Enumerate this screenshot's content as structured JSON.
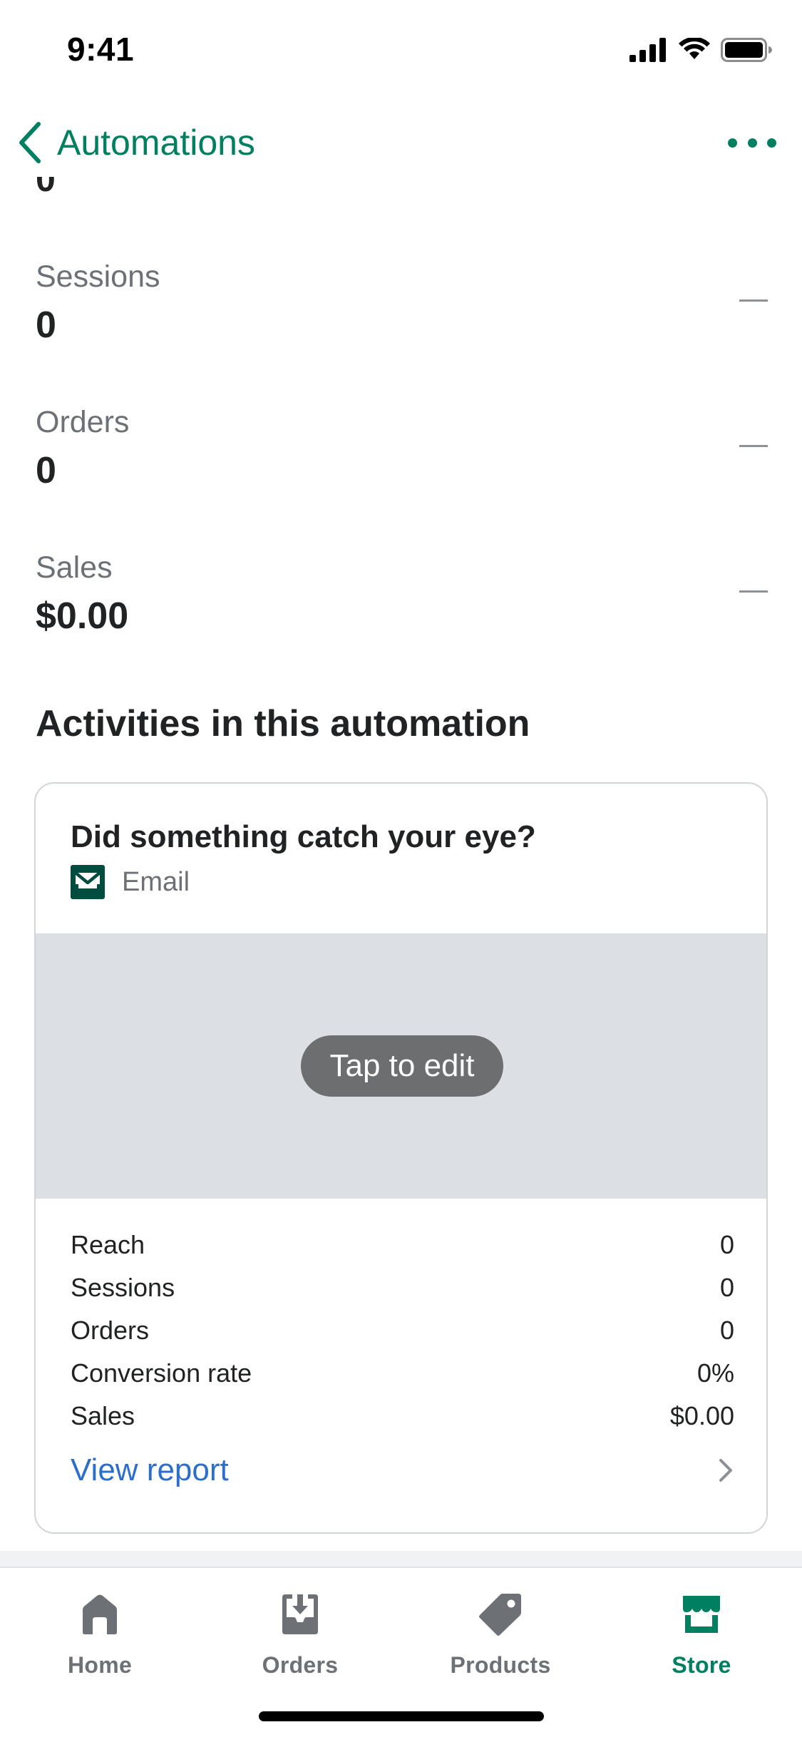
{
  "status_bar": {
    "time": "9:41"
  },
  "nav": {
    "back_label": "Automations"
  },
  "clipped_metric_value": "0",
  "metrics": [
    {
      "label": "Sessions",
      "value": "0"
    },
    {
      "label": "Orders",
      "value": "0"
    },
    {
      "label": "Sales",
      "value": "$0.00"
    }
  ],
  "section_heading": "Activities in this automation",
  "activity": {
    "title": "Did something catch your eye?",
    "type_label": "Email",
    "tap_to_edit": "Tap to edit",
    "stats": [
      {
        "label": "Reach",
        "value": "0"
      },
      {
        "label": "Sessions",
        "value": "0"
      },
      {
        "label": "Orders",
        "value": "0"
      },
      {
        "label": "Conversion rate",
        "value": "0%"
      },
      {
        "label": "Sales",
        "value": "$0.00"
      }
    ],
    "view_report": "View report"
  },
  "tabs": [
    {
      "label": "Home",
      "icon": "home-icon"
    },
    {
      "label": "Orders",
      "icon": "orders-icon"
    },
    {
      "label": "Products",
      "icon": "tag-icon"
    },
    {
      "label": "Store",
      "icon": "store-icon",
      "active": true
    }
  ],
  "colors": {
    "accent": "#008060",
    "link": "#2c6ecb",
    "muted_text": "#6d7175",
    "primary_text": "#202223",
    "preview_background": "#dcdfe3",
    "email_icon": "#004c3f"
  }
}
